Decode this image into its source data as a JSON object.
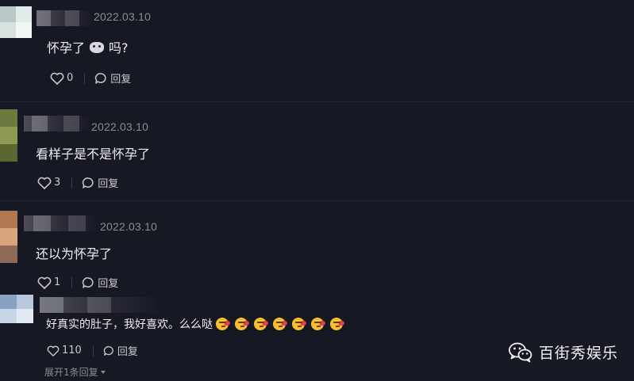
{
  "comments": [
    {
      "date": "2022.03.10",
      "text_before": "怀孕了",
      "text_after": "吗?",
      "likes": "0",
      "reply_label": "回复"
    },
    {
      "date": "2022.03.10",
      "text": "看样子是不是怀孕了",
      "likes": "3",
      "reply_label": "回复"
    },
    {
      "date": "2022.03.10",
      "text": "还以为怀孕了",
      "likes": "1",
      "reply_label": "回复"
    },
    {
      "text": "好真实的肚子，我好喜欢。么么哒",
      "emoji_count": 7,
      "likes": "110",
      "reply_label": "回复",
      "expand_label": "展开1条回复"
    }
  ],
  "icons": {
    "like": "heart-outline-icon",
    "reply": "speech-bubble-icon",
    "emoji": "face-blowing-kiss-icon",
    "inline_emoji": "cat-face-icon",
    "expand": "caret-down-icon",
    "watermark": "wechat-logo-icon"
  },
  "watermark": {
    "label": "百街秀娱乐"
  },
  "colors": {
    "background": "#161823",
    "text": "#eeeef0",
    "muted": "#8b8c92",
    "emoji_yellow": "#f6c02d",
    "emoji_heart": "#e93a56"
  }
}
